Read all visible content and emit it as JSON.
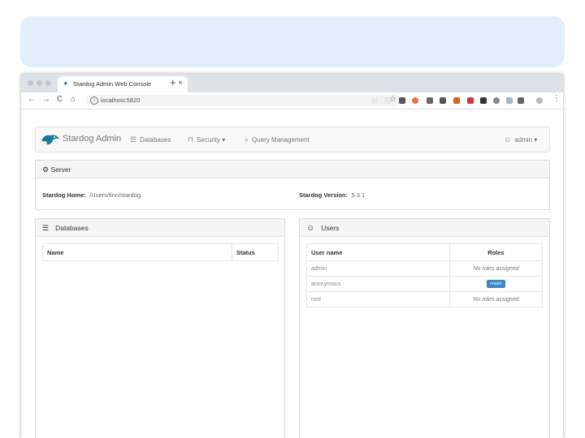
{
  "browser": {
    "tab_title": "Stardog Admin Web Console",
    "tab_close": "×",
    "new_tab": "+",
    "url": "localhost:5820",
    "nav": {
      "back": "←",
      "forward": "→",
      "reload": "C",
      "home": "⌂"
    },
    "star": "☆",
    "menu": "⋮"
  },
  "navbar": {
    "brand": "Stardog Admin",
    "items": [
      {
        "label": "Databases",
        "icon": "database-icon"
      },
      {
        "label": "Security ▾",
        "icon": "lock-icon"
      },
      {
        "label": "Query Management",
        "icon": "search-icon"
      }
    ],
    "user": "admin ▾"
  },
  "server": {
    "title": "Server",
    "home_label": "Stardog Home:",
    "home_value": "/Users/finn/stardog",
    "version_label": "Stardog Version:",
    "version_value": "5.3.1"
  },
  "databases": {
    "title": "Databases",
    "columns": [
      "Name",
      "Status"
    ]
  },
  "users": {
    "title": "Users",
    "columns": [
      "User name",
      "Roles"
    ],
    "rows": [
      {
        "name": "admin",
        "role": "No roles assigned",
        "type": "text"
      },
      {
        "name": "anonymous",
        "role": "reader",
        "type": "badge"
      },
      {
        "name": "root",
        "role": "No roles assigned",
        "type": "text"
      }
    ]
  },
  "colors": {
    "banner": "#e1effd",
    "badge": "#3b86c6",
    "logo": "#1a7d9a"
  }
}
